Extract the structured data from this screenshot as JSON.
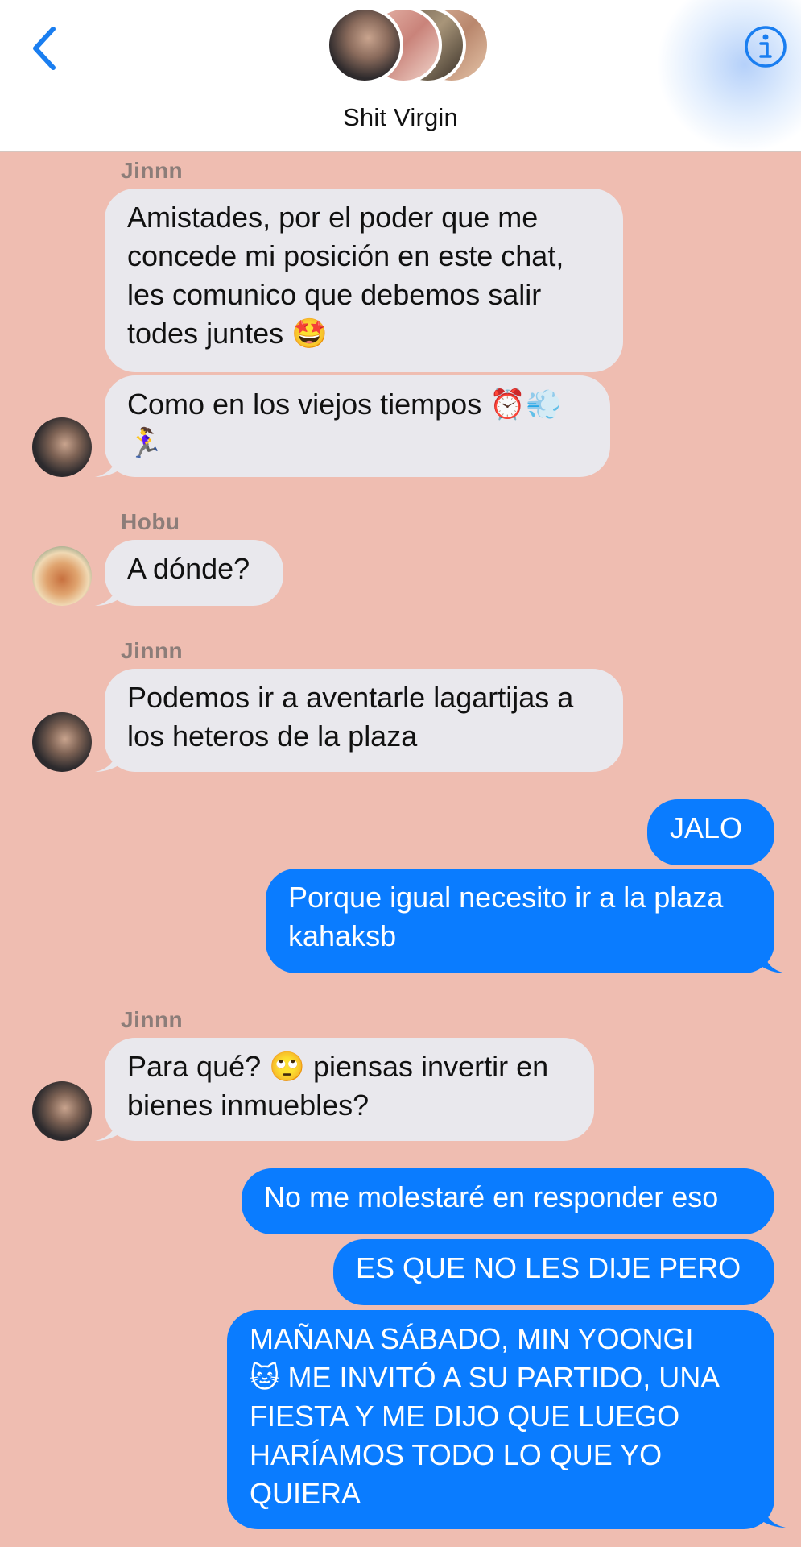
{
  "header": {
    "title": "Shit Virgin",
    "back_icon": "chevron-left-icon",
    "info_icon": "info-icon"
  },
  "colors": {
    "background": "#efbdb1",
    "incoming_bubble": "#e9e8ed",
    "outgoing_bubble": "#0a7cff",
    "accent": "#1a7ef0"
  },
  "messages": [
    {
      "sender": "Jinnn",
      "text": "Amistades, por el poder que me\nconcede mi posición en este chat,\nles comunico que debemos salir\ntodes juntes 🤩"
    },
    {
      "text": "Como en los viejos tiempos ⏰💨\n🏃‍♀️"
    },
    {
      "sender": "Hobu",
      "text": "A dónde?"
    },
    {
      "sender": "Jinnn",
      "text": "Podemos ir a aventarle lagartijas a\nlos heteros de la plaza"
    },
    {
      "text": "JALO"
    },
    {
      "text": "Porque igual necesito ir a la plaza\nkahaksb"
    },
    {
      "sender": "Jinnn",
      "text": "Para qué? 🙄 piensas invertir en\nbienes inmuebles?"
    },
    {
      "text": "No me molestaré en responder eso"
    },
    {
      "text": "ES QUE NO LES DIJE PERO"
    },
    {
      "text": "MAÑANA SÁBADO, MIN YOONGI\n🐱 ME INVITÓ A SU PARTIDO, UNA\nFIESTA Y ME DIJO QUE LUEGO\nHARÍAMOS TODO LO QUE YO\nQUIERA"
    }
  ]
}
